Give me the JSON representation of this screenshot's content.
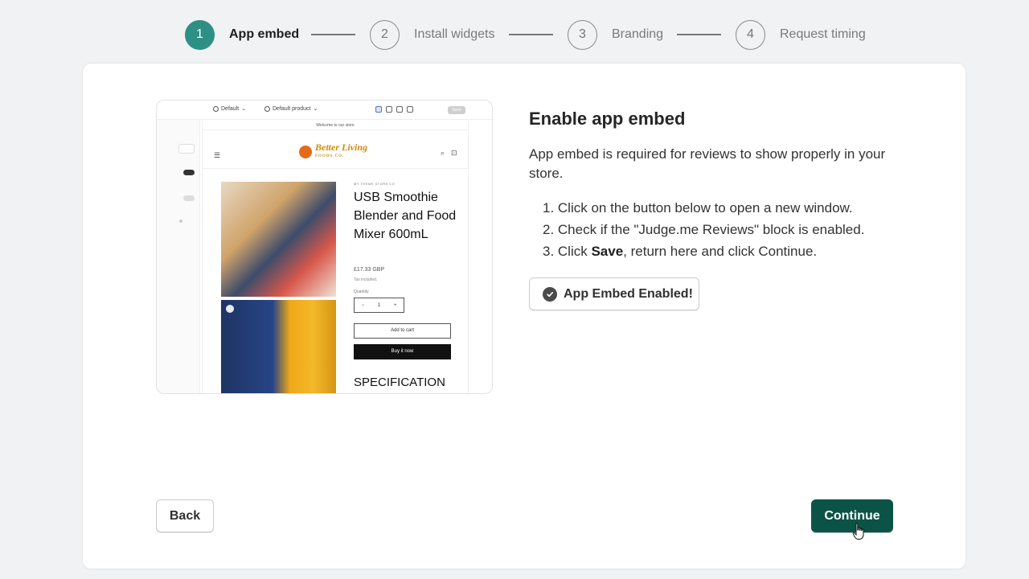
{
  "stepper": {
    "steps": [
      {
        "number": "1",
        "label": "App embed",
        "active": true
      },
      {
        "number": "2",
        "label": "Install widgets",
        "active": false
      },
      {
        "number": "3",
        "label": "Branding",
        "active": false
      },
      {
        "number": "4",
        "label": "Request timing",
        "active": false
      }
    ]
  },
  "preview": {
    "toolbar": {
      "theme": "Default",
      "template": "Default product",
      "save": "Save"
    },
    "banner": "Welcome to our store",
    "logo": {
      "name": "Better Living",
      "sub": "FOODS CO."
    },
    "product": {
      "vendor": "MY THEME STORE CO",
      "title": "USB Smoothie Blender and Food Mixer 600mL",
      "price": "£17.33 GBP",
      "tax": "Tax included.",
      "quantity_label": "Quantity",
      "quantity": "1",
      "add_to_cart": "Add to cart",
      "buy_now": "Buy it now",
      "spec": "SPECIFICATION"
    }
  },
  "content": {
    "heading": "Enable app embed",
    "description": "App embed is required for reviews to show properly in your store.",
    "steps": {
      "s1": "Click on the button below to open a new window.",
      "s2": "Check if the \"Judge.me Reviews\" block is enabled.",
      "s3_pre": "Click ",
      "s3_bold": "Save",
      "s3_post": ", return here and click Continue."
    },
    "embed_button": "App Embed Enabled!"
  },
  "footer": {
    "back": "Back",
    "continue": "Continue"
  },
  "colors": {
    "active_step": "#2e8f85",
    "primary_button": "#0b5346",
    "background": "#f1f2f4"
  }
}
